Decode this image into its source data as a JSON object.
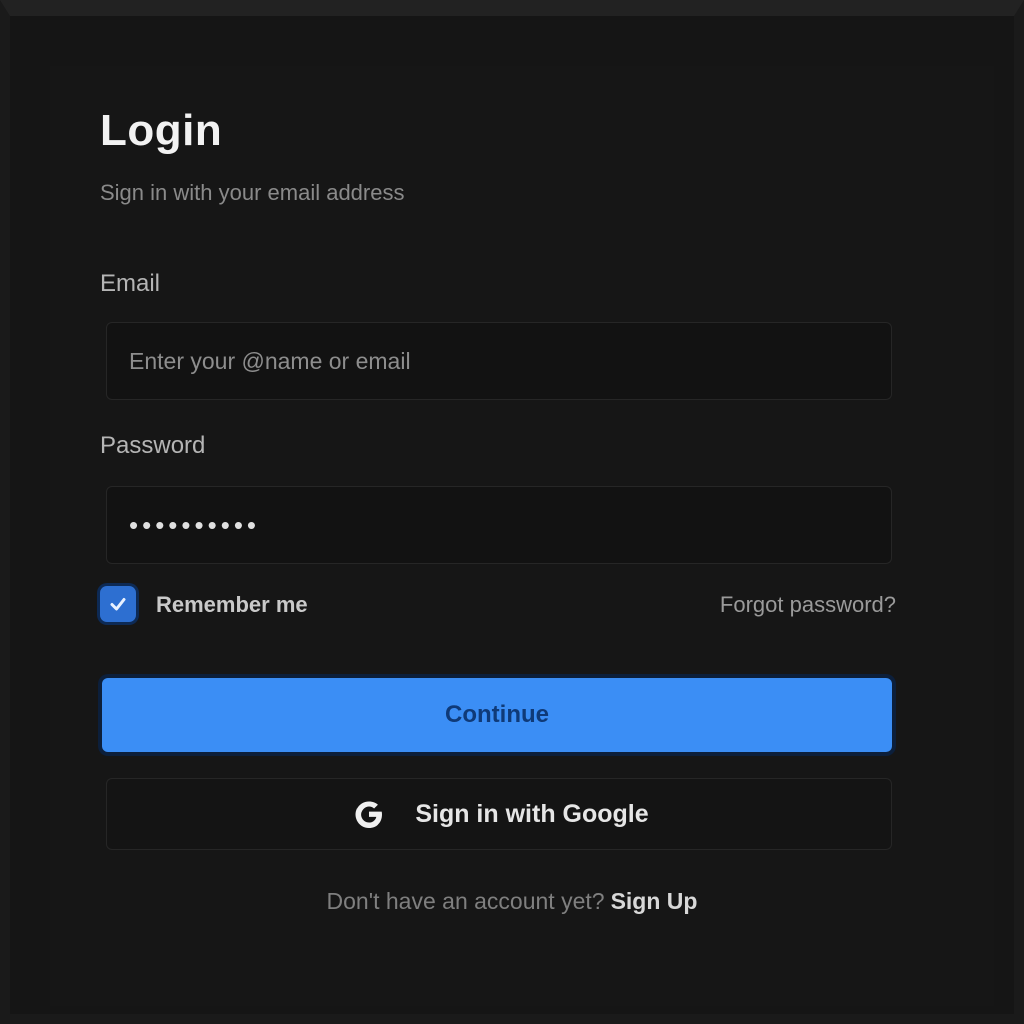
{
  "login": {
    "title": "Login",
    "subtitle": "Sign in with your email address",
    "email_label": "Email",
    "email_placeholder": "Enter your @name or email",
    "password_label": "Password",
    "password_value": "••••••••••",
    "remember_label": "Remember me",
    "remember_checked": true,
    "forgot_password": "Forgot password?",
    "continue_label": "Continue",
    "google_label": "Sign in with Google",
    "signup_prompt": "Don't have an account yet?",
    "signup_link": "Sign Up"
  },
  "icons": {
    "checkbox": "check-icon",
    "google": "google-icon"
  },
  "colors": {
    "background": "#151515",
    "accent": "#3b8ef5",
    "accent_text": "#0f3a78",
    "checkbox": "#2d6fd1"
  }
}
